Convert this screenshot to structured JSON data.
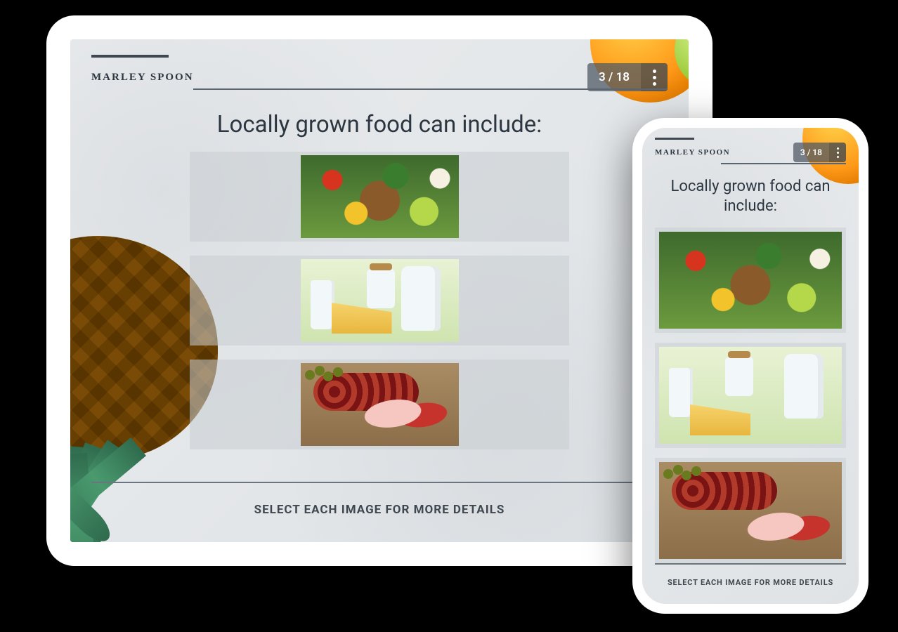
{
  "brand": "MARLEY SPOON",
  "progress": {
    "current": 3,
    "total": 18,
    "display": "3 / 18"
  },
  "title_tablet": "Locally grown food can include:",
  "title_phone": "Locally grown food can include:",
  "instruction": "SELECT EACH IMAGE FOR MORE DETAILS",
  "cards": [
    {
      "name": "produce",
      "alt": "Fresh produce, bread and grains"
    },
    {
      "name": "dairy",
      "alt": "Milk, cheese and dairy"
    },
    {
      "name": "meats",
      "alt": "Cured meats and charcuterie"
    }
  ]
}
